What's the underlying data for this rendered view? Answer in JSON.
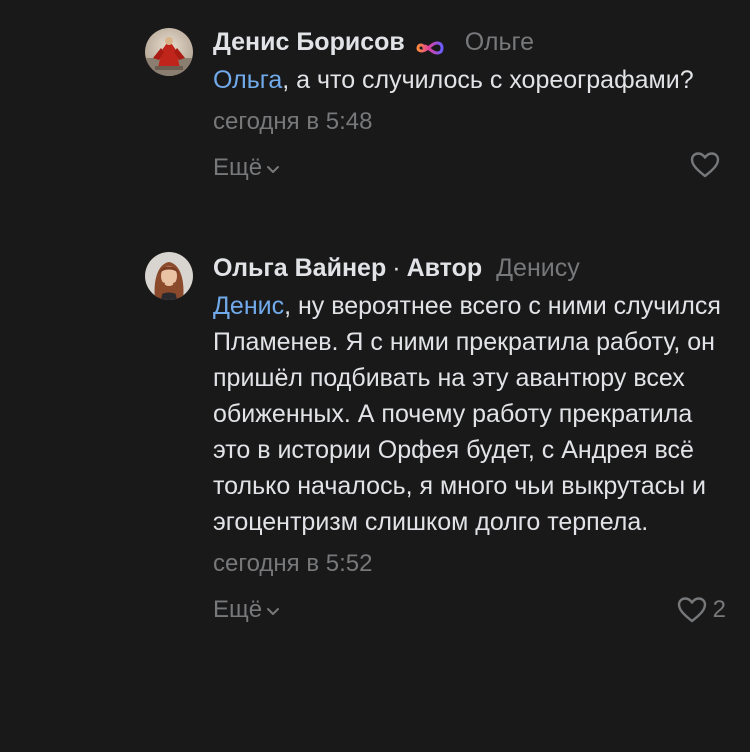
{
  "comments": [
    {
      "author": "Денис Борисов",
      "author_badge_icon": "infinity-icon",
      "reply_to": "Ольге",
      "mention": "Ольга",
      "text": ", а что случилось с хореографами?",
      "date": "сегодня в 5:48",
      "more_label": "Ещё",
      "likes": ""
    },
    {
      "author": "Ольга Вайнер",
      "separator": "·",
      "author_tag": "Автор",
      "reply_to": "Денису",
      "mention": "Денис",
      "text": ", ну вероятнее всего с ними случился Пламенев. Я с ними прекратила работу, он пришёл подбивать на эту авантюру всех обиженных. А почему работу прекратила это в истории Орфея будет, с Андрея всё только началось, я много чьи выкрутасы и эгоцентризм слишком долго терпела.",
      "date": "сегодня в 5:52",
      "more_label": "Ещё",
      "likes": "2"
    }
  ],
  "colors": {
    "background": "#19191a",
    "text": "#e1e3e6",
    "secondary": "#76787a",
    "link": "#71aaeb"
  }
}
